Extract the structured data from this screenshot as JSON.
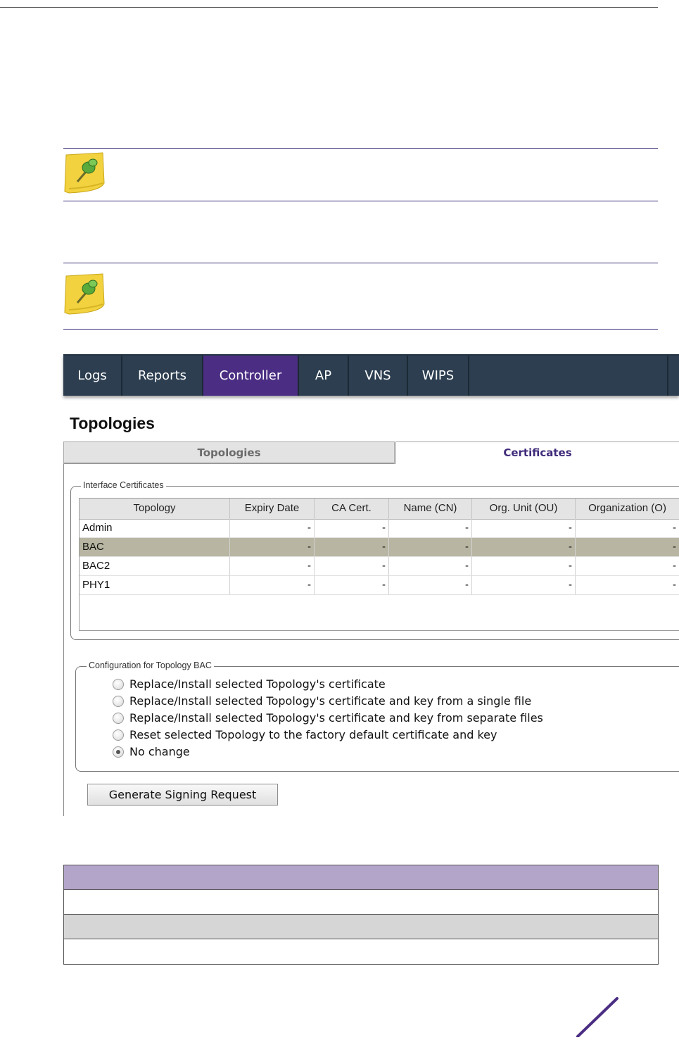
{
  "nav": {
    "tabs": [
      {
        "label": "Logs"
      },
      {
        "label": "Reports"
      },
      {
        "label": "Controller",
        "active": true
      },
      {
        "label": "AP"
      },
      {
        "label": "VNS"
      },
      {
        "label": "WIPS"
      }
    ]
  },
  "page": {
    "title": "Topologies",
    "tabs": [
      {
        "label": "Topologies",
        "active": false
      },
      {
        "label": "Certificates",
        "active": true
      }
    ]
  },
  "interface_certificates": {
    "legend": "Interface Certificates",
    "columns": [
      "Topology",
      "Expiry Date",
      "CA Cert.",
      "Name (CN)",
      "Org. Unit (OU)",
      "Organization (O)"
    ],
    "rows": [
      {
        "cells": [
          "Admin",
          "-",
          "-",
          "-",
          "-",
          "-"
        ],
        "selected": false
      },
      {
        "cells": [
          "BAC",
          "-",
          "-",
          "-",
          "-",
          "-"
        ],
        "selected": true
      },
      {
        "cells": [
          "BAC2",
          "-",
          "-",
          "-",
          "-",
          "-"
        ],
        "selected": false
      },
      {
        "cells": [
          "PHY1",
          "-",
          "-",
          "-",
          "-",
          "-"
        ],
        "selected": false
      }
    ]
  },
  "configuration": {
    "legend": "Configuration for Topology BAC",
    "options": [
      {
        "label": "Replace/Install selected Topology's certificate",
        "checked": false
      },
      {
        "label": "Replace/Install selected Topology's certificate and key from a single file",
        "checked": false
      },
      {
        "label": "Replace/Install selected Topology's certificate and key from separate files",
        "checked": false
      },
      {
        "label": "Reset selected Topology to the factory default certificate and key",
        "checked": false
      },
      {
        "label": "No change",
        "checked": true
      }
    ]
  },
  "buttons": {
    "generate_signing_request": "Generate Signing Request"
  },
  "colors": {
    "nav_background": "#2c3e50",
    "nav_active": "#4b2d83",
    "selected_row": "#b8b5a2",
    "table_header_band": "#b3a4c9",
    "table_gray_band": "#d6d6d6",
    "brand_accent": "#4b2d83"
  },
  "icons": {
    "note": "pushpin-note-icon",
    "brand_mark": "brand-slash-icon"
  }
}
